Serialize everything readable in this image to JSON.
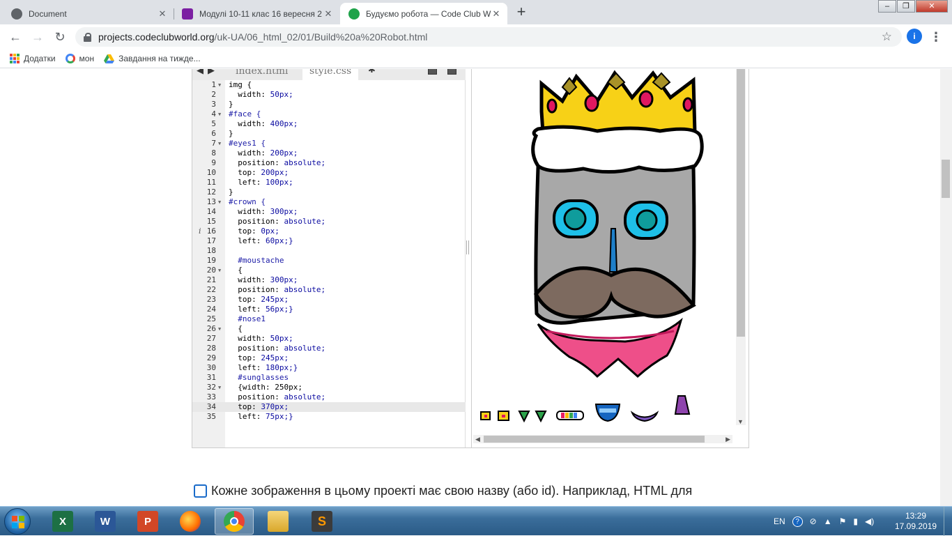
{
  "browser": {
    "tabs": [
      {
        "title": "Document",
        "favicon_color": "#5f6368"
      },
      {
        "title": "Модулі 10-11 клас 16 вересня 2",
        "favicon_color": "#7b1fa2"
      },
      {
        "title": "Будуємо робота — Code Club W",
        "favicon_color": "#1fa34a"
      }
    ],
    "new_tab": "+",
    "url_host": "projects.codeclubworld.org",
    "url_path": "/uk-UA/06_html_02/01/Build%20a%20Robot.html",
    "profile_initial": "i",
    "bookmarks": [
      {
        "label": "Додатки",
        "icon": "apps-grid-icon"
      },
      {
        "label": "мон",
        "icon": "google-circle-icon"
      },
      {
        "label": "Завдання на тижде...",
        "icon": "google-drive-icon"
      }
    ]
  },
  "editor": {
    "file_tabs": [
      "index.html",
      "style.css"
    ],
    "active_file": "style.css",
    "highlight_line": 34,
    "code_lines": [
      {
        "n": "1",
        "t": "img {",
        "fold": true
      },
      {
        "n": "2",
        "t": "  width: 50px;"
      },
      {
        "n": "3",
        "t": "}"
      },
      {
        "n": "4",
        "t": "#face {",
        "fold": true
      },
      {
        "n": "5",
        "t": "  width: 400px;"
      },
      {
        "n": "6",
        "t": "}"
      },
      {
        "n": "7",
        "t": "#eyes1 {",
        "fold": true
      },
      {
        "n": "8",
        "t": "  width: 200px;"
      },
      {
        "n": "9",
        "t": "  position: absolute;"
      },
      {
        "n": "10",
        "t": "  top: 200px;"
      },
      {
        "n": "11",
        "t": "  left: 100px;"
      },
      {
        "n": "12",
        "t": "}"
      },
      {
        "n": "13",
        "t": "#crown {",
        "fold": true
      },
      {
        "n": "14",
        "t": "  width: 300px;"
      },
      {
        "n": "15",
        "t": "  position: absolute;"
      },
      {
        "n": "16",
        "t": "  top: 0px;",
        "info": true
      },
      {
        "n": "17",
        "t": "  left: 60px;}"
      },
      {
        "n": "18",
        "t": ""
      },
      {
        "n": "19",
        "t": "  #moustache"
      },
      {
        "n": "20",
        "t": "  {",
        "fold": true
      },
      {
        "n": "21",
        "t": "  width: 300px;"
      },
      {
        "n": "22",
        "t": "  position: absolute;"
      },
      {
        "n": "23",
        "t": "  top: 245px;"
      },
      {
        "n": "24",
        "t": "  left: 56px;}"
      },
      {
        "n": "25",
        "t": "  #nose1"
      },
      {
        "n": "26",
        "t": "  {",
        "fold": true
      },
      {
        "n": "27",
        "t": "  width: 50px;"
      },
      {
        "n": "28",
        "t": "  position: absolute;"
      },
      {
        "n": "29",
        "t": "  top: 245px;"
      },
      {
        "n": "30",
        "t": "  left: 180px;}"
      },
      {
        "n": "31",
        "t": "  #sunglasses"
      },
      {
        "n": "32",
        "t": "  {width: 250px;",
        "fold": true
      },
      {
        "n": "33",
        "t": "  position: absolute;"
      },
      {
        "n": "34",
        "t": "  top: 370px;"
      },
      {
        "n": "35",
        "t": "  left: 75px;}"
      }
    ]
  },
  "instruction_text": "Кожне зображення в цьому проекті має свою назву (або id). Наприклад, HTML для",
  "taskbar": {
    "apps": [
      "excel",
      "word",
      "powerpoint",
      "firefox",
      "chrome",
      "explorer",
      "sublime-text"
    ],
    "active_app": "chrome",
    "language": "EN",
    "time": "13:29",
    "date": "17.09.2019"
  },
  "colors": {
    "robot_face": "#a8a8a8",
    "robot_eye": "#1ec0e8",
    "robot_pupil": "#0f9c9c",
    "crown": "#f7d117",
    "crown_gem": "#e01860",
    "moustache": "#7d6a5f",
    "bowtie": "#ee4f89"
  }
}
